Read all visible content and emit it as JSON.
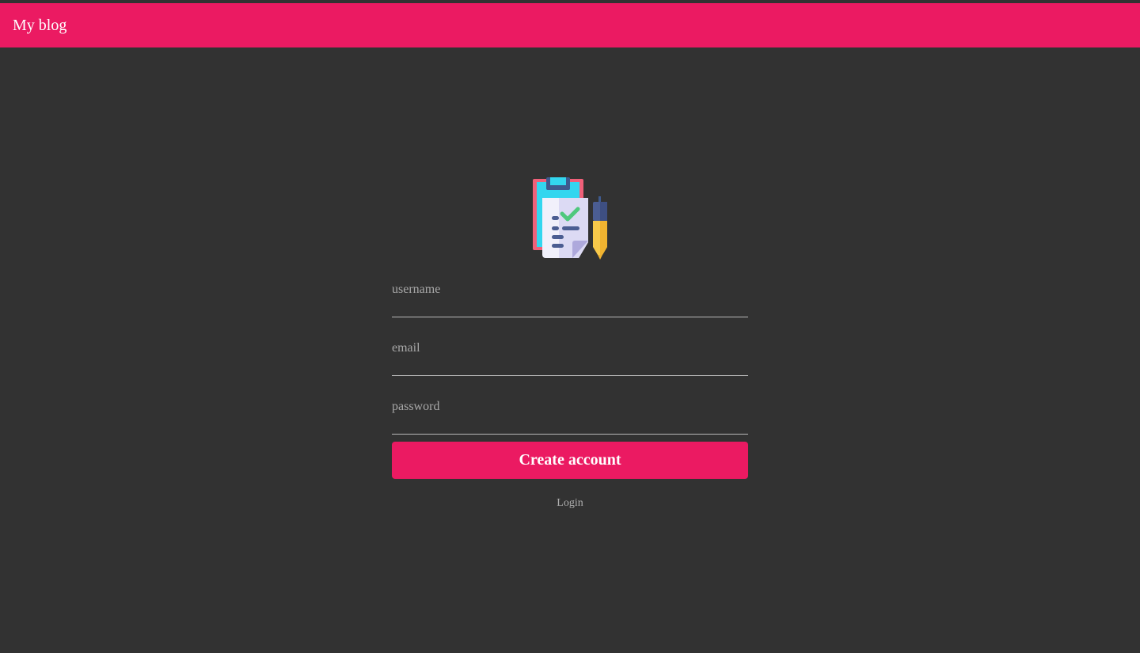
{
  "navbar": {
    "brand": "My blog",
    "color": "#eb1a62"
  },
  "logo": {
    "icon": "clipboard-with-pen-icon"
  },
  "form": {
    "username": {
      "value": "",
      "placeholder": "username"
    },
    "email": {
      "value": "",
      "placeholder": "email"
    },
    "password": {
      "value": "",
      "placeholder": "password"
    },
    "submit_label": "Create account",
    "login_label": "Login"
  },
  "colors": {
    "background": "#323232",
    "accent": "#eb1a62"
  }
}
